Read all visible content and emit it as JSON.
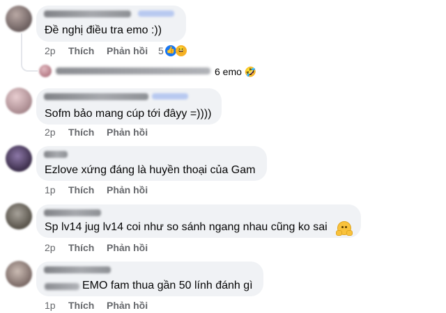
{
  "comments": [
    {
      "text": "Đề nghị điều tra emo :))",
      "time": "2p",
      "like": "Thích",
      "reply": "Phản hồi",
      "reaction_count": "5"
    },
    {
      "text": "Sofm bảo mang cúp tới đâyy =))))",
      "time": "2p",
      "like": "Thích",
      "reply": "Phản hồi"
    },
    {
      "text": "Ezlove xứng đáng là huyền thoại của Gam",
      "time": "1p",
      "like": "Thích",
      "reply": "Phản hồi"
    },
    {
      "text": "Sp lv14 jug lv14 coi như so sánh ngang nhau cũng ko sai",
      "time": "2p",
      "like": "Thích",
      "reply": "Phản hồi",
      "trailing_emoji": "hugging-face"
    },
    {
      "text": "EMO fam thua gần 50 lính đánh gì",
      "time": "1p",
      "like": "Thích",
      "reply": "Phản hồi"
    }
  ],
  "reply_preview": {
    "text": "6 emo",
    "emoji": "rolling-on-floor-laughing"
  },
  "icons": {
    "like": "like-reaction-icon",
    "haha": "haha-reaction-icon"
  },
  "colors": {
    "bubble": "#f0f2f5",
    "action": "#65676b",
    "like_blue": "#1877f2"
  }
}
